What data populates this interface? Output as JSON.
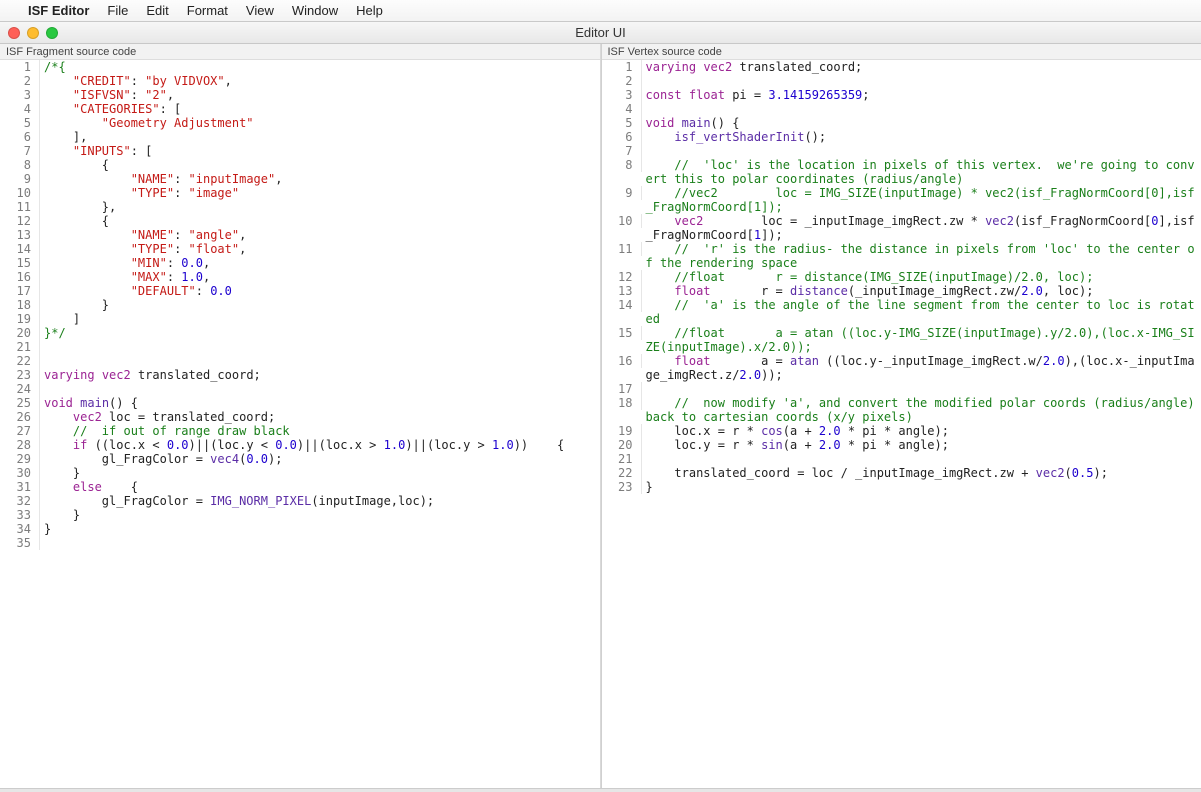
{
  "menubar": {
    "apple": "",
    "appname": "ISF Editor",
    "items": [
      "File",
      "Edit",
      "Format",
      "View",
      "Window",
      "Help"
    ]
  },
  "window": {
    "title": "Editor UI"
  },
  "left": {
    "label": "ISF Fragment source code",
    "lines": [
      {
        "n": 1,
        "t": [
          [
            "c-comment",
            "/*{"
          ]
        ]
      },
      {
        "n": 2,
        "t": [
          [
            "",
            "    "
          ],
          [
            "c-key",
            "\"CREDIT\""
          ],
          [
            "",
            ": "
          ],
          [
            "c-string",
            "\"by VIDVOX\""
          ],
          [
            "",
            ","
          ]
        ]
      },
      {
        "n": 3,
        "t": [
          [
            "",
            "    "
          ],
          [
            "c-key",
            "\"ISFVSN\""
          ],
          [
            "",
            ": "
          ],
          [
            "c-string",
            "\"2\""
          ],
          [
            "",
            ","
          ]
        ]
      },
      {
        "n": 4,
        "t": [
          [
            "",
            "    "
          ],
          [
            "c-key",
            "\"CATEGORIES\""
          ],
          [
            "",
            ": ["
          ]
        ]
      },
      {
        "n": 5,
        "t": [
          [
            "",
            "        "
          ],
          [
            "c-string",
            "\"Geometry Adjustment\""
          ]
        ]
      },
      {
        "n": 6,
        "t": [
          [
            "",
            "    ],"
          ]
        ]
      },
      {
        "n": 7,
        "t": [
          [
            "",
            "    "
          ],
          [
            "c-key",
            "\"INPUTS\""
          ],
          [
            "",
            ": ["
          ]
        ]
      },
      {
        "n": 8,
        "t": [
          [
            "",
            "        {"
          ]
        ]
      },
      {
        "n": 9,
        "t": [
          [
            "",
            "            "
          ],
          [
            "c-key",
            "\"NAME\""
          ],
          [
            "",
            ": "
          ],
          [
            "c-string",
            "\"inputImage\""
          ],
          [
            "",
            ","
          ]
        ]
      },
      {
        "n": 10,
        "t": [
          [
            "",
            "            "
          ],
          [
            "c-key",
            "\"TYPE\""
          ],
          [
            "",
            ": "
          ],
          [
            "c-string",
            "\"image\""
          ]
        ]
      },
      {
        "n": 11,
        "t": [
          [
            "",
            "        },"
          ]
        ]
      },
      {
        "n": 12,
        "t": [
          [
            "",
            "        {"
          ]
        ]
      },
      {
        "n": 13,
        "t": [
          [
            "",
            "            "
          ],
          [
            "c-key",
            "\"NAME\""
          ],
          [
            "",
            ": "
          ],
          [
            "c-string",
            "\"angle\""
          ],
          [
            "",
            ","
          ]
        ]
      },
      {
        "n": 14,
        "t": [
          [
            "",
            "            "
          ],
          [
            "c-key",
            "\"TYPE\""
          ],
          [
            "",
            ": "
          ],
          [
            "c-string",
            "\"float\""
          ],
          [
            "",
            ","
          ]
        ]
      },
      {
        "n": 15,
        "t": [
          [
            "",
            "            "
          ],
          [
            "c-key",
            "\"MIN\""
          ],
          [
            "",
            ": "
          ],
          [
            "c-number",
            "0.0"
          ],
          [
            "",
            ","
          ]
        ]
      },
      {
        "n": 16,
        "t": [
          [
            "",
            "            "
          ],
          [
            "c-key",
            "\"MAX\""
          ],
          [
            "",
            ": "
          ],
          [
            "c-number",
            "1.0"
          ],
          [
            "",
            ","
          ]
        ]
      },
      {
        "n": 17,
        "t": [
          [
            "",
            "            "
          ],
          [
            "c-key",
            "\"DEFAULT\""
          ],
          [
            "",
            ": "
          ],
          [
            "c-number",
            "0.0"
          ]
        ]
      },
      {
        "n": 18,
        "t": [
          [
            "",
            "        }"
          ]
        ]
      },
      {
        "n": 19,
        "t": [
          [
            "",
            "    ]"
          ]
        ]
      },
      {
        "n": 20,
        "t": [
          [
            "c-comment",
            "}*/"
          ]
        ]
      },
      {
        "n": 21,
        "t": [
          [
            "",
            ""
          ]
        ]
      },
      {
        "n": 22,
        "t": [
          [
            "",
            ""
          ]
        ]
      },
      {
        "n": 23,
        "t": [
          [
            "c-keyword",
            "varying"
          ],
          [
            "",
            " "
          ],
          [
            "c-type",
            "vec2"
          ],
          [
            "",
            " translated_coord;"
          ]
        ]
      },
      {
        "n": 24,
        "t": [
          [
            "",
            ""
          ]
        ]
      },
      {
        "n": 25,
        "t": [
          [
            "c-keyword",
            "void"
          ],
          [
            "",
            " "
          ],
          [
            "c-func",
            "main"
          ],
          [
            "",
            "() {"
          ]
        ]
      },
      {
        "n": 26,
        "t": [
          [
            "",
            "    "
          ],
          [
            "c-type",
            "vec2"
          ],
          [
            "",
            " loc = translated_coord;"
          ]
        ]
      },
      {
        "n": 27,
        "t": [
          [
            "",
            "    "
          ],
          [
            "c-comment",
            "//  if out of range draw black"
          ]
        ]
      },
      {
        "n": 28,
        "t": [
          [
            "",
            "    "
          ],
          [
            "c-keyword",
            "if"
          ],
          [
            "",
            " ((loc.x < "
          ],
          [
            "c-number",
            "0.0"
          ],
          [
            "",
            ")||(loc.y < "
          ],
          [
            "c-number",
            "0.0"
          ],
          [
            "",
            ")||(loc.x > "
          ],
          [
            "c-number",
            "1.0"
          ],
          [
            "",
            ")||(loc.y > "
          ],
          [
            "c-number",
            "1.0"
          ],
          [
            "",
            "))    {"
          ]
        ]
      },
      {
        "n": 29,
        "t": [
          [
            "",
            "        gl_FragColor = "
          ],
          [
            "c-func",
            "vec4"
          ],
          [
            "",
            "("
          ],
          [
            "c-number",
            "0.0"
          ],
          [
            "",
            ");"
          ]
        ]
      },
      {
        "n": 30,
        "t": [
          [
            "",
            "    }"
          ]
        ]
      },
      {
        "n": 31,
        "t": [
          [
            "",
            "    "
          ],
          [
            "c-keyword",
            "else"
          ],
          [
            "",
            "    {"
          ]
        ]
      },
      {
        "n": 32,
        "t": [
          [
            "",
            "        gl_FragColor = "
          ],
          [
            "c-func",
            "IMG_NORM_PIXEL"
          ],
          [
            "",
            "(inputImage,loc);"
          ]
        ]
      },
      {
        "n": 33,
        "t": [
          [
            "",
            "    }"
          ]
        ]
      },
      {
        "n": 34,
        "t": [
          [
            "",
            "}"
          ]
        ]
      },
      {
        "n": 35,
        "t": [
          [
            "",
            ""
          ]
        ]
      }
    ]
  },
  "right": {
    "label": "ISF Vertex source code",
    "lines": [
      {
        "n": 1,
        "t": [
          [
            "c-keyword",
            "varying"
          ],
          [
            "",
            " "
          ],
          [
            "c-type",
            "vec2"
          ],
          [
            "",
            " translated_coord;"
          ]
        ]
      },
      {
        "n": 2,
        "t": [
          [
            "",
            ""
          ]
        ]
      },
      {
        "n": 3,
        "t": [
          [
            "c-keyword",
            "const"
          ],
          [
            "",
            " "
          ],
          [
            "c-type",
            "float"
          ],
          [
            "",
            " pi = "
          ],
          [
            "c-number",
            "3.14159265359"
          ],
          [
            "",
            ";"
          ]
        ]
      },
      {
        "n": 4,
        "t": [
          [
            "",
            ""
          ]
        ]
      },
      {
        "n": 5,
        "t": [
          [
            "c-keyword",
            "void"
          ],
          [
            "",
            " "
          ],
          [
            "c-func",
            "main"
          ],
          [
            "",
            "() {"
          ]
        ]
      },
      {
        "n": 6,
        "t": [
          [
            "",
            "    "
          ],
          [
            "c-func",
            "isf_vertShaderInit"
          ],
          [
            "",
            "();"
          ]
        ]
      },
      {
        "n": 7,
        "t": [
          [
            "",
            ""
          ]
        ]
      },
      {
        "n": 8,
        "t": [
          [
            "",
            "    "
          ],
          [
            "c-comment",
            "//  'loc' is the location in pixels of this vertex.  we're going to convert this to polar coordinates (radius/angle)"
          ]
        ]
      },
      {
        "n": 9,
        "t": [
          [
            "",
            "    "
          ],
          [
            "c-comment",
            "//vec2        loc = IMG_SIZE(inputImage) * vec2(isf_FragNormCoord[0],isf_FragNormCoord[1]);"
          ]
        ]
      },
      {
        "n": 10,
        "t": [
          [
            "",
            "    "
          ],
          [
            "c-type",
            "vec2"
          ],
          [
            "",
            "        loc = _inputImage_imgRect.zw * "
          ],
          [
            "c-func",
            "vec2"
          ],
          [
            "",
            "(isf_FragNormCoord["
          ],
          [
            "c-number",
            "0"
          ],
          [
            "",
            "],isf_FragNormCoord["
          ],
          [
            "c-number",
            "1"
          ],
          [
            "",
            "]);"
          ]
        ]
      },
      {
        "n": 11,
        "t": [
          [
            "",
            "    "
          ],
          [
            "c-comment",
            "//  'r' is the radius- the distance in pixels from 'loc' to the center of the rendering space"
          ]
        ]
      },
      {
        "n": 12,
        "t": [
          [
            "",
            "    "
          ],
          [
            "c-comment",
            "//float       r = distance(IMG_SIZE(inputImage)/2.0, loc);"
          ]
        ]
      },
      {
        "n": 13,
        "t": [
          [
            "",
            "    "
          ],
          [
            "c-type",
            "float"
          ],
          [
            "",
            "       r = "
          ],
          [
            "c-func",
            "distance"
          ],
          [
            "",
            "(_inputImage_imgRect.zw/"
          ],
          [
            "c-number",
            "2.0"
          ],
          [
            "",
            ", loc);"
          ]
        ]
      },
      {
        "n": 14,
        "t": [
          [
            "",
            "    "
          ],
          [
            "c-comment",
            "//  'a' is the angle of the line segment from the center to loc is rotated"
          ]
        ]
      },
      {
        "n": 15,
        "t": [
          [
            "",
            "    "
          ],
          [
            "c-comment",
            "//float       a = atan ((loc.y-IMG_SIZE(inputImage).y/2.0),(loc.x-IMG_SIZE(inputImage).x/2.0));"
          ]
        ]
      },
      {
        "n": 16,
        "t": [
          [
            "",
            "    "
          ],
          [
            "c-type",
            "float"
          ],
          [
            "",
            "       a = "
          ],
          [
            "c-func",
            "atan"
          ],
          [
            "",
            " ((loc.y-_inputImage_imgRect.w/"
          ],
          [
            "c-number",
            "2.0"
          ],
          [
            "",
            "),(loc.x-_inputImage_imgRect.z/"
          ],
          [
            "c-number",
            "2.0"
          ],
          [
            "",
            "));"
          ]
        ]
      },
      {
        "n": 17,
        "t": [
          [
            "",
            ""
          ]
        ]
      },
      {
        "n": 18,
        "t": [
          [
            "",
            "    "
          ],
          [
            "c-comment",
            "//  now modify 'a', and convert the modified polar coords (radius/angle) back to cartesian coords (x/y pixels)"
          ]
        ]
      },
      {
        "n": 19,
        "t": [
          [
            "",
            "    loc.x = r * "
          ],
          [
            "c-func",
            "cos"
          ],
          [
            "",
            "(a + "
          ],
          [
            "c-number",
            "2.0"
          ],
          [
            "",
            " * pi * angle);"
          ]
        ]
      },
      {
        "n": 20,
        "t": [
          [
            "",
            "    loc.y = r * "
          ],
          [
            "c-func",
            "sin"
          ],
          [
            "",
            "(a + "
          ],
          [
            "c-number",
            "2.0"
          ],
          [
            "",
            " * pi * angle);"
          ]
        ]
      },
      {
        "n": 21,
        "t": [
          [
            "",
            ""
          ]
        ]
      },
      {
        "n": 22,
        "t": [
          [
            "",
            "    translated_coord = loc / _inputImage_imgRect.zw + "
          ],
          [
            "c-func",
            "vec2"
          ],
          [
            "",
            "("
          ],
          [
            "c-number",
            "0.5"
          ],
          [
            "",
            ");"
          ]
        ]
      },
      {
        "n": 23,
        "t": [
          [
            "",
            "}"
          ]
        ]
      }
    ]
  }
}
